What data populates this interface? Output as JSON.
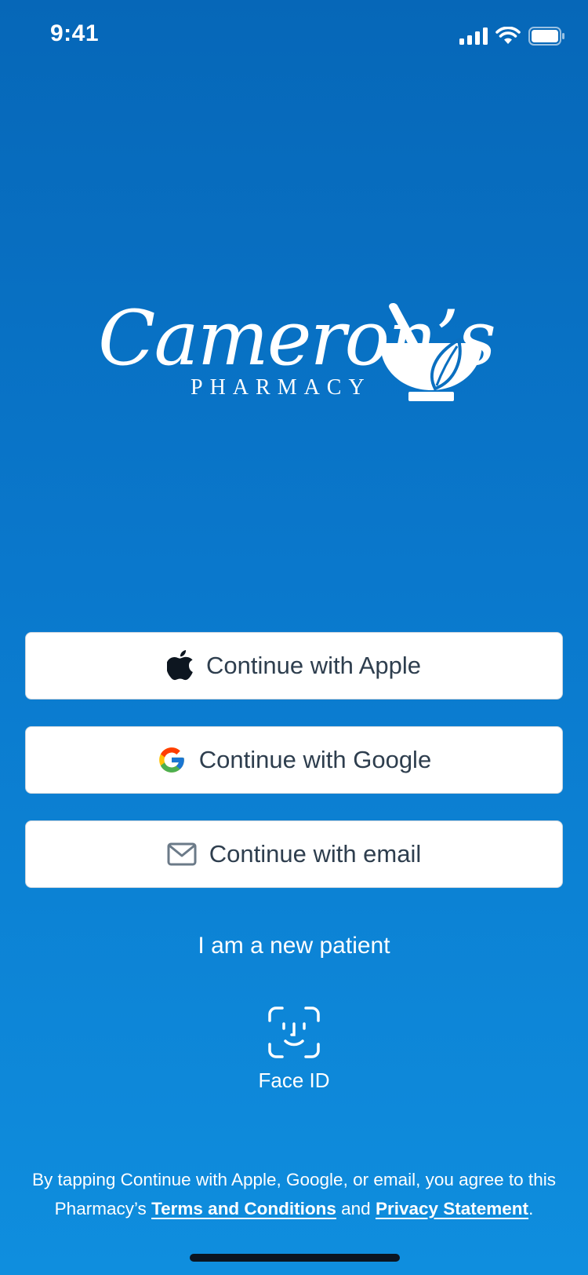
{
  "status_bar": {
    "time": "9:41",
    "icons": [
      "cellular-signal-icon",
      "wifi-icon",
      "battery-icon"
    ]
  },
  "logo": {
    "script_text": "Cameron’s",
    "sub_text": "PHARMACY",
    "icon": "mortar-pestle-leaf-icon"
  },
  "auth": {
    "apple_label": "Continue with Apple",
    "google_label": "Continue with Google",
    "email_label": "Continue with email"
  },
  "new_patient_label": "I am a new patient",
  "face_id_label": "Face ID",
  "legal": {
    "prefix": "By tapping Continue with Apple, Google, or email, you agree to this Pharmacy’s ",
    "terms_link": "Terms and Conditions",
    "middle": " and ",
    "privacy_link": "Privacy Statement",
    "suffix": "."
  },
  "colors": {
    "background_top": "#0667b8",
    "background_bottom": "#0f8ede",
    "button_text": "#2e3e4e",
    "white": "#ffffff"
  }
}
